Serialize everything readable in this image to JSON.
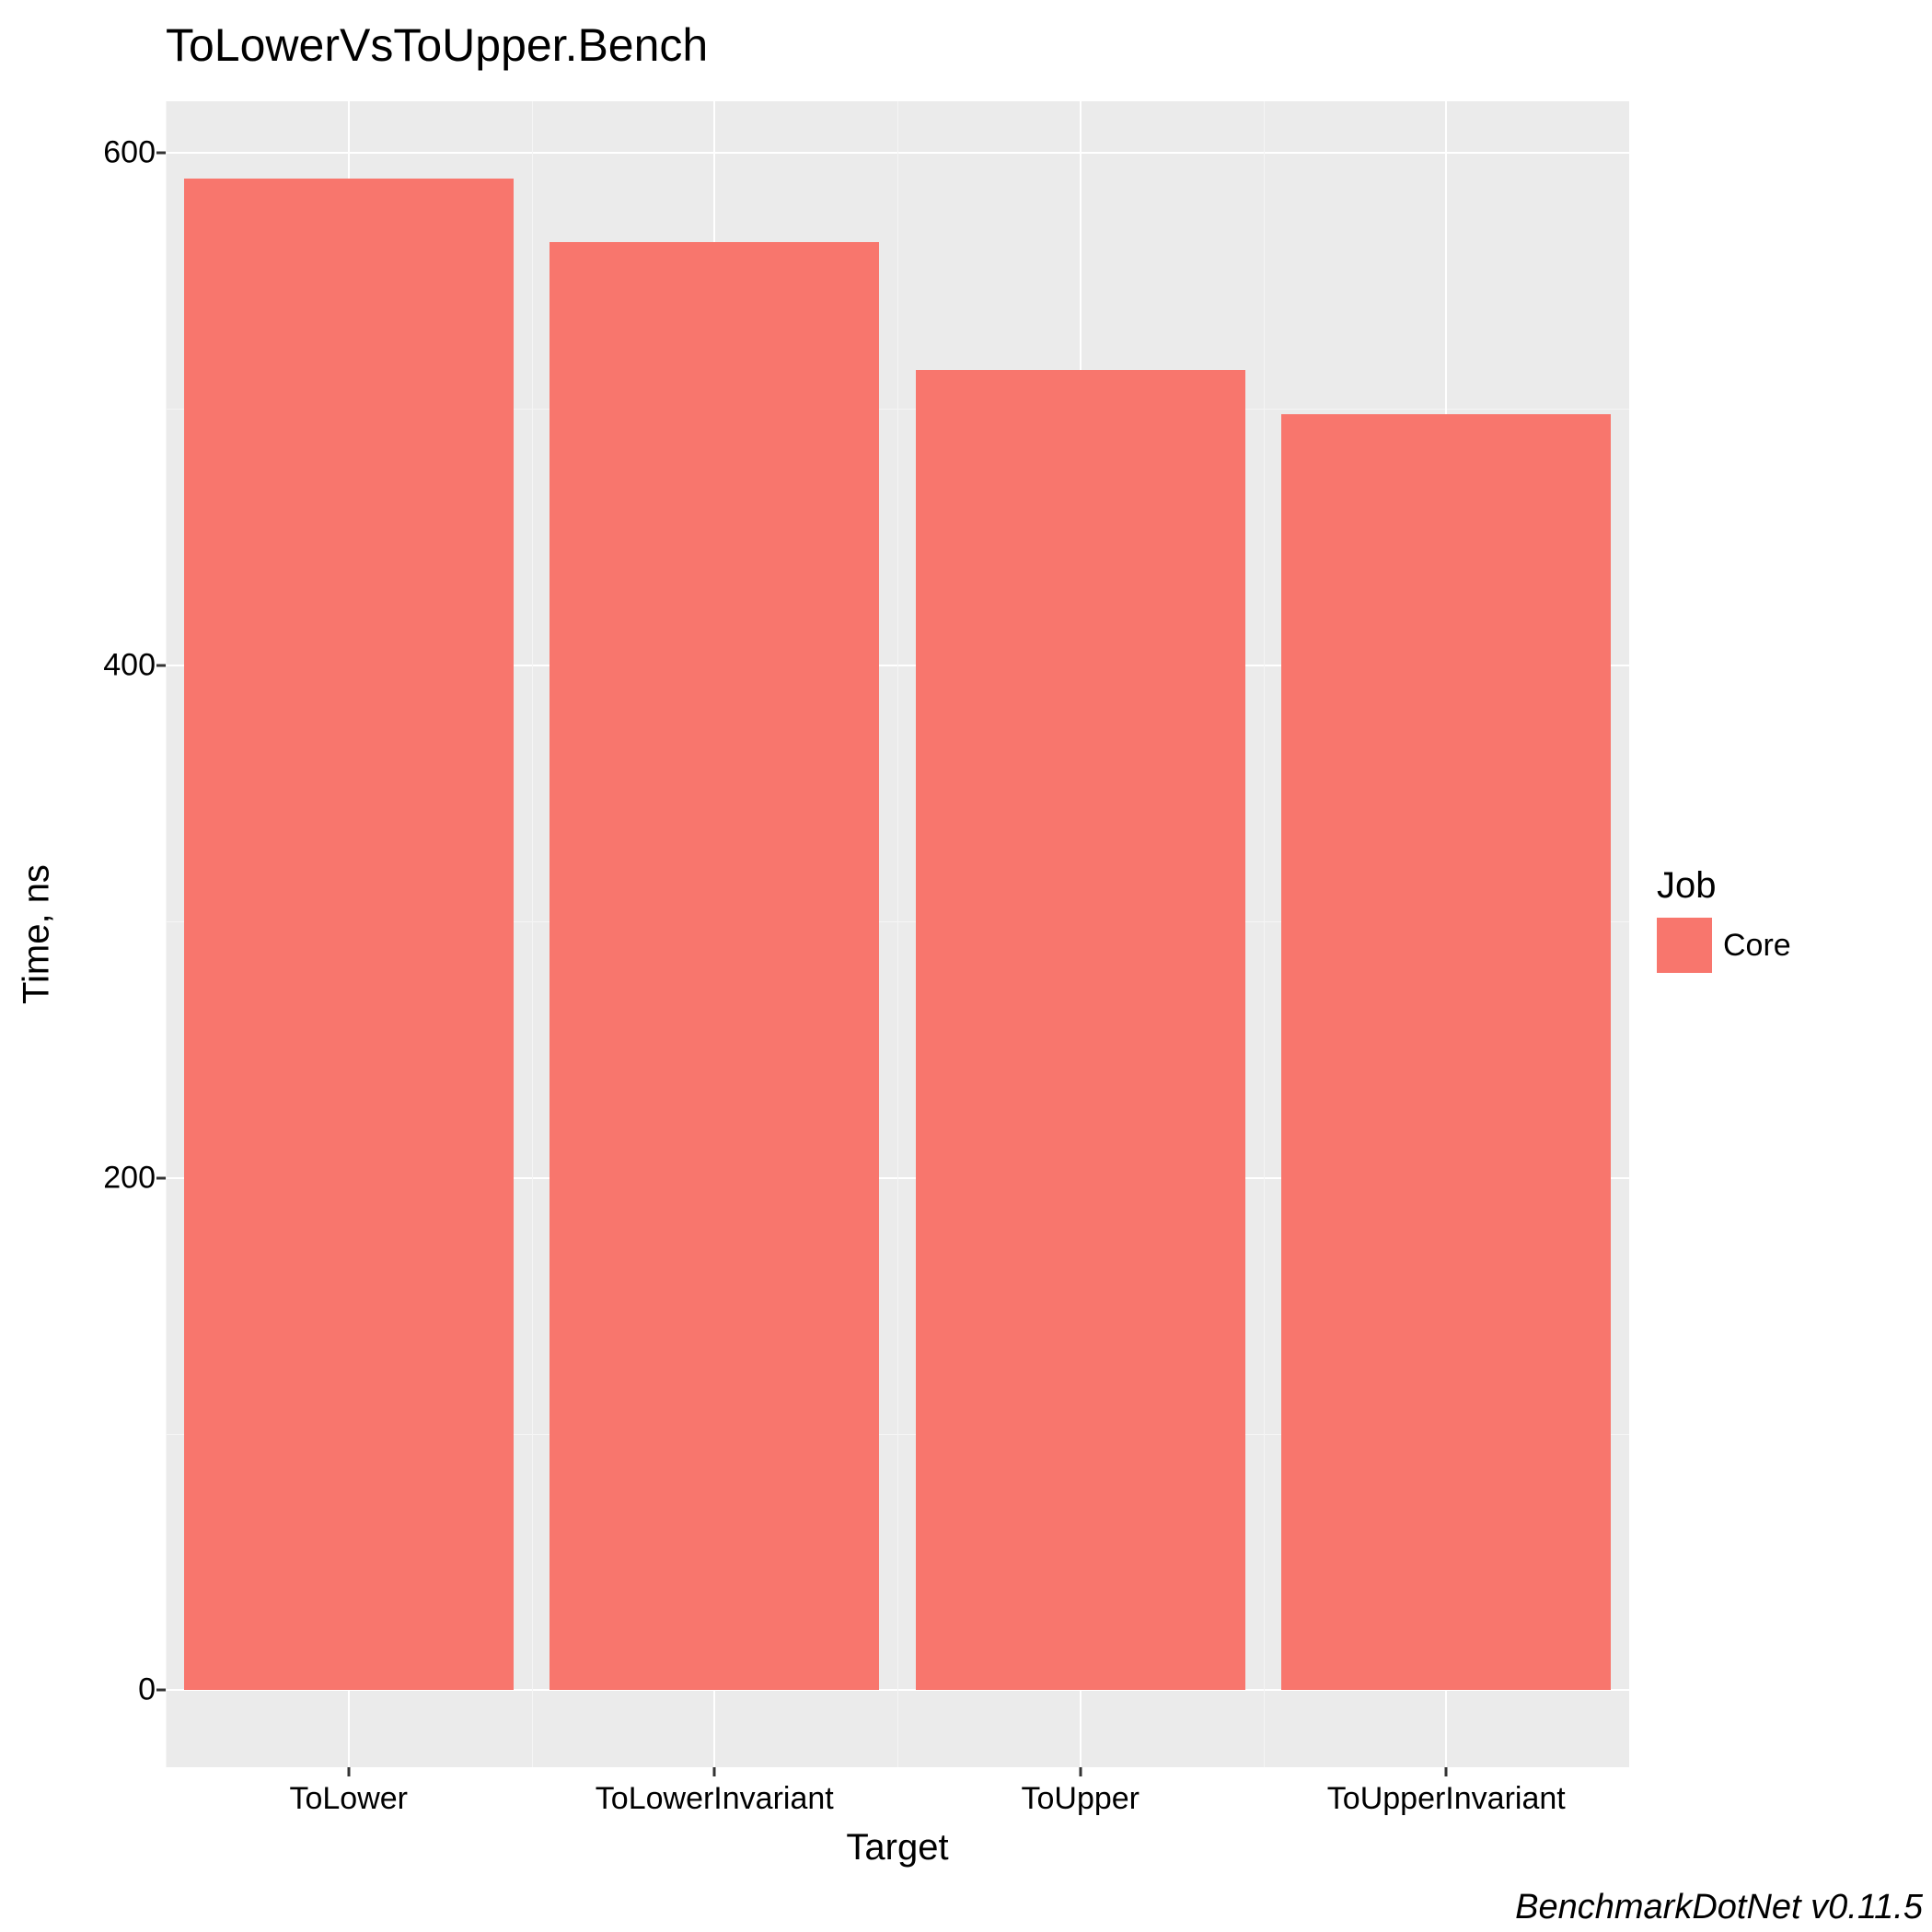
{
  "chart_data": {
    "type": "bar",
    "title": "ToLowerVsToUpper.Bench",
    "xlabel": "Target",
    "ylabel": "Time, ns",
    "caption": "BenchmarkDotNet v0.11.5",
    "categories": [
      "ToLower",
      "ToLowerInvariant",
      "ToUpper",
      "ToUpperInvariant"
    ],
    "series": [
      {
        "name": "Core",
        "values": [
          590,
          565,
          515,
          498
        ],
        "color": "#f8766d"
      }
    ],
    "legend_title": "Job",
    "y_ticks": [
      0,
      200,
      400,
      600
    ],
    "y_minor": [
      100,
      300,
      500
    ],
    "ylim": [
      -30,
      620
    ]
  }
}
